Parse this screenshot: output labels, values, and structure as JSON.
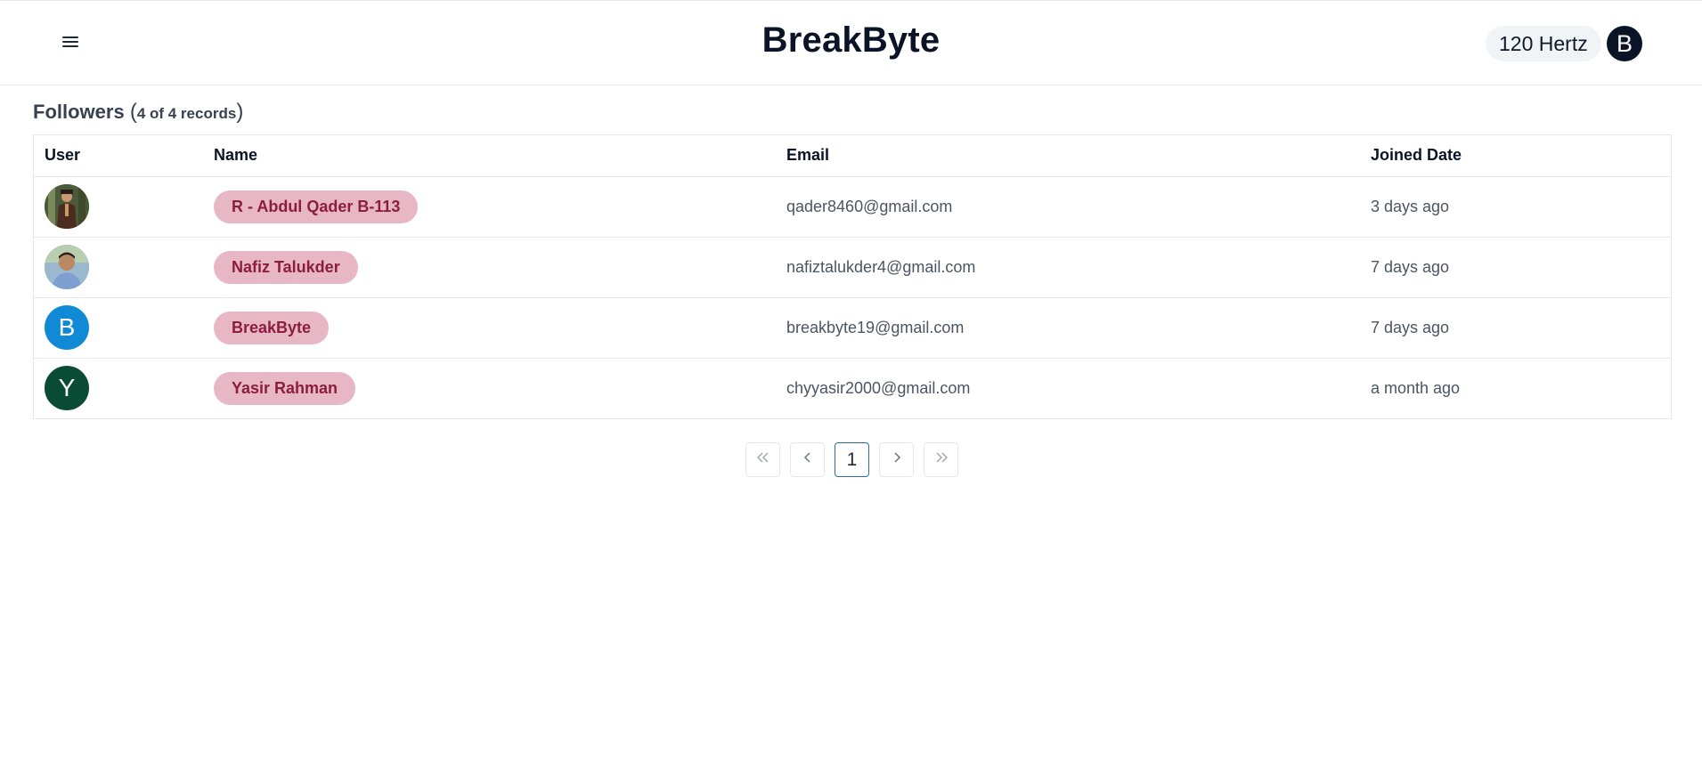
{
  "header": {
    "brand": "BreakByte",
    "user_chip": "120 Hertz",
    "avatar_letter": "B"
  },
  "section": {
    "title": "Followers",
    "count_text": "4 of 4 records",
    "paren_open": "(",
    "paren_close": ")"
  },
  "table": {
    "columns": [
      "User",
      "Name",
      "Email",
      "Joined Date"
    ],
    "rows": [
      {
        "avatar": "photo",
        "avatar_letter": "",
        "name": "R - Abdul Qader B-113",
        "email": "qader8460@gmail.com",
        "joined": "3 days ago"
      },
      {
        "avatar": "photo",
        "avatar_letter": "",
        "name": "Nafiz Talukder",
        "email": "nafiztalukder4@gmail.com",
        "joined": "7 days ago"
      },
      {
        "avatar": "letter",
        "avatar_letter": "B",
        "avatar_color": "#118ad6",
        "name": "BreakByte",
        "email": "breakbyte19@gmail.com",
        "joined": "7 days ago"
      },
      {
        "avatar": "letter",
        "avatar_letter": "Y",
        "avatar_color": "#0a4b35",
        "name": "Yasir Rahman",
        "email": "chyyasir2000@gmail.com",
        "joined": "a month ago"
      }
    ]
  },
  "pagination": {
    "first": "«",
    "prev": "‹",
    "current": "1",
    "next": "›",
    "last": "»"
  },
  "colors": {
    "pill_bg": "#e7b7c6",
    "pill_text": "#8c1d3f",
    "brand_text": "#0b1326",
    "active_page_border": "#2b6f9e"
  }
}
